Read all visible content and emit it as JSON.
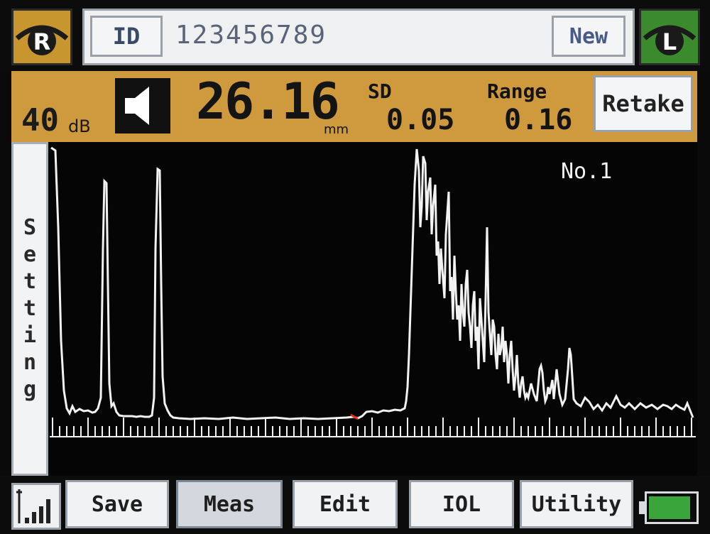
{
  "header": {
    "right_eye_label": "R",
    "left_eye_label": "L",
    "id_label": "ID",
    "patient_id": "123456789",
    "new_button": "New"
  },
  "measurement": {
    "gain_value": "40",
    "gain_unit": "dB",
    "axial_length": "26.16",
    "axial_unit": "mm",
    "sd_label": "SD",
    "sd_value": "0.05",
    "range_label": "Range",
    "range_value": "0.16",
    "retake_button": "Retake"
  },
  "sidebar": {
    "setting_label": "Setting",
    "letters": [
      "S",
      "e",
      "t",
      "t",
      "i",
      "n",
      "g"
    ]
  },
  "waveform": {
    "scan_label": "No.1"
  },
  "nav": {
    "save": "Save",
    "meas": "Meas",
    "edit": "Edit",
    "iol": "IOL",
    "utility": "Utility"
  },
  "status": {
    "battery_level": 0.9,
    "signal_bars": 4
  },
  "colors": {
    "right_eye": "#c8962e",
    "left_eye": "#3b8a2e",
    "measurement_bar": "#cf9a3e",
    "trace": "#f2f2f2",
    "gate_marker": "#e03020",
    "battery": "#3aa53a"
  },
  "icons": {
    "right_eye": "eye-icon",
    "left_eye": "eye-icon",
    "sound": "speaker-icon",
    "signal": "signal-strength-icon",
    "battery": "battery-icon"
  }
}
